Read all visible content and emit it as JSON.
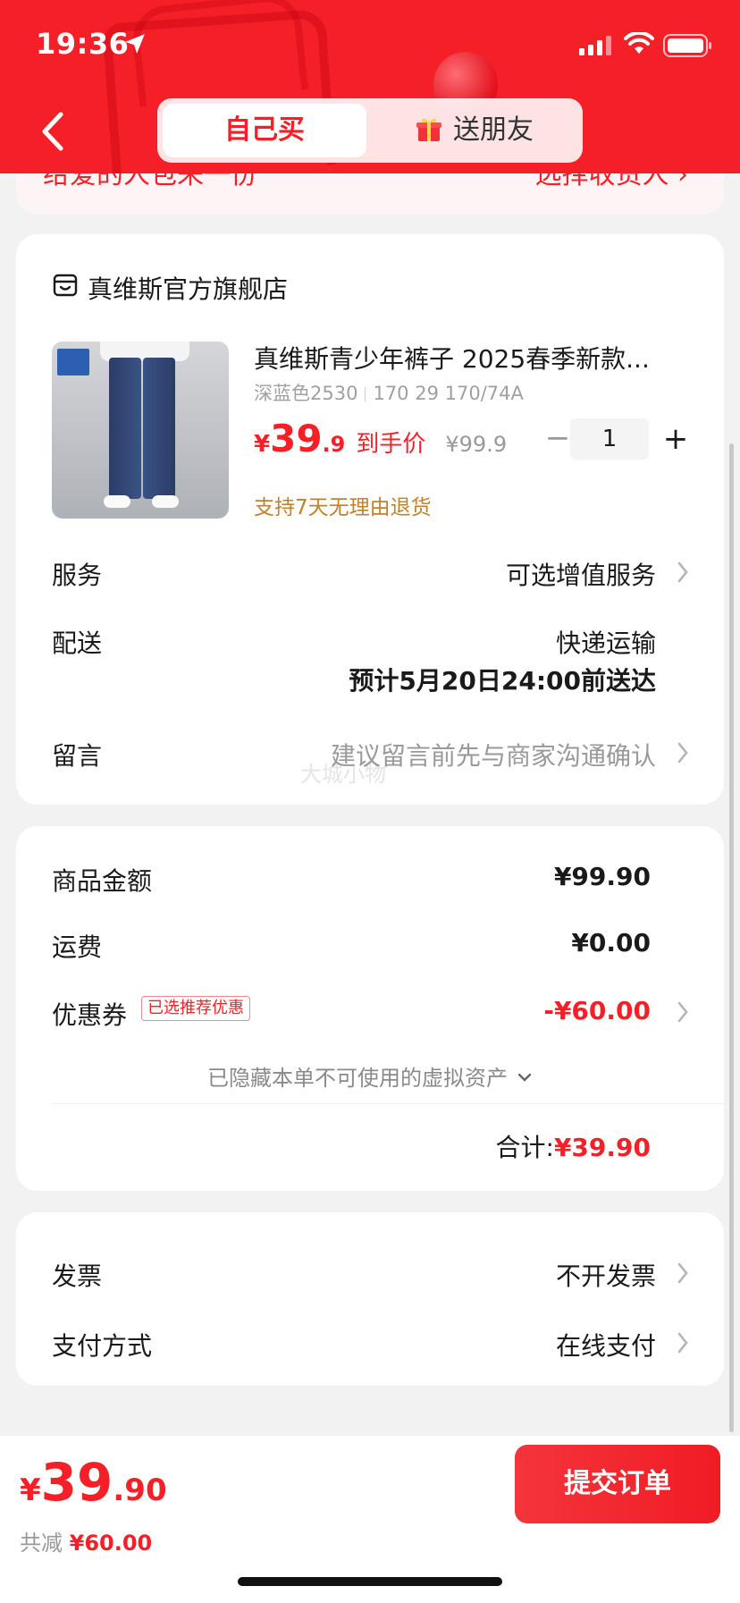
{
  "status_bar": {
    "time": "19:36"
  },
  "header": {
    "tab_self": "自己买",
    "tab_gift": "送朋友"
  },
  "address_peek": {
    "left_text": "给爱的人包来一份",
    "right_text": "选择收货人 ›"
  },
  "shop": {
    "name": "真维斯官方旗舰店"
  },
  "product": {
    "title": "真维斯青少年裤子 2025春季新款...",
    "spec_color": "深蓝色2530",
    "spec_size": "170 29 170/74A",
    "price_currency": "¥",
    "price_int": "39",
    "price_dec": ".9",
    "price_label": "到手价",
    "original_price": "¥99.9",
    "quantity": "1",
    "return_note": "支持7天无理由退货"
  },
  "rows": {
    "service_label": "服务",
    "service_value": "可选增值服务",
    "delivery_label": "配送",
    "delivery_method": "快递运输",
    "delivery_eta": "预计5月20日24:00前送达",
    "message_label": "留言",
    "message_placeholder": "建议留言前先与商家沟通确认",
    "watermark": "大城小物"
  },
  "summary": {
    "goods_label": "商品金额",
    "goods_value": "¥99.90",
    "shipping_label": "运费",
    "shipping_value": "¥0.00",
    "coupon_label": "优惠券",
    "coupon_tag": "已选推荐优惠",
    "coupon_value": "-¥60.00",
    "hidden_assets": "已隐藏本单不可使用的虚拟资产",
    "total_label": "合计:",
    "total_value": "¥39.90"
  },
  "payment": {
    "invoice_label": "发票",
    "invoice_value": "不开发票",
    "method_label": "支付方式",
    "method_value": "在线支付"
  },
  "bottom": {
    "currency": "¥",
    "total_int": "39",
    "total_dec": ".90",
    "saved_label": "共减",
    "saved_value": "¥60.00",
    "submit": "提交订单"
  },
  "colors": {
    "brand_red": "#f51f28",
    "return_note": "#c2812a"
  }
}
